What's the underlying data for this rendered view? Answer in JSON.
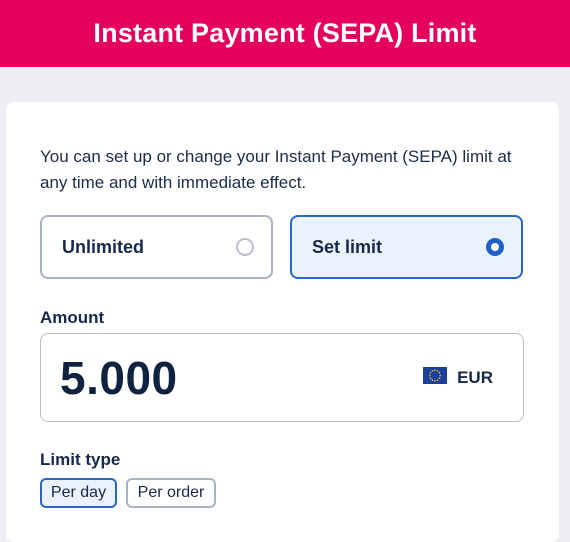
{
  "header": {
    "title": "Instant Payment (SEPA) Limit",
    "color": "#e4005c"
  },
  "intro": {
    "text": "You can set up or change your Instant Payment (SEPA) limit at any time and with immediate effect."
  },
  "options": [
    {
      "label": "Unlimited",
      "selected": false
    },
    {
      "label": "Set limit",
      "selected": true
    }
  ],
  "amount": {
    "label": "Amount",
    "value": "5.000",
    "currency": "EUR",
    "currency_icon": "eu-flag-icon"
  },
  "limit_type": {
    "label": "Limit type",
    "options": [
      {
        "label": "Per day",
        "selected": true
      },
      {
        "label": "Per order",
        "selected": false
      }
    ]
  },
  "colors": {
    "accent": "#2a68c8",
    "selected_bg": "#eaf2fd",
    "brand": "#e4005c"
  }
}
